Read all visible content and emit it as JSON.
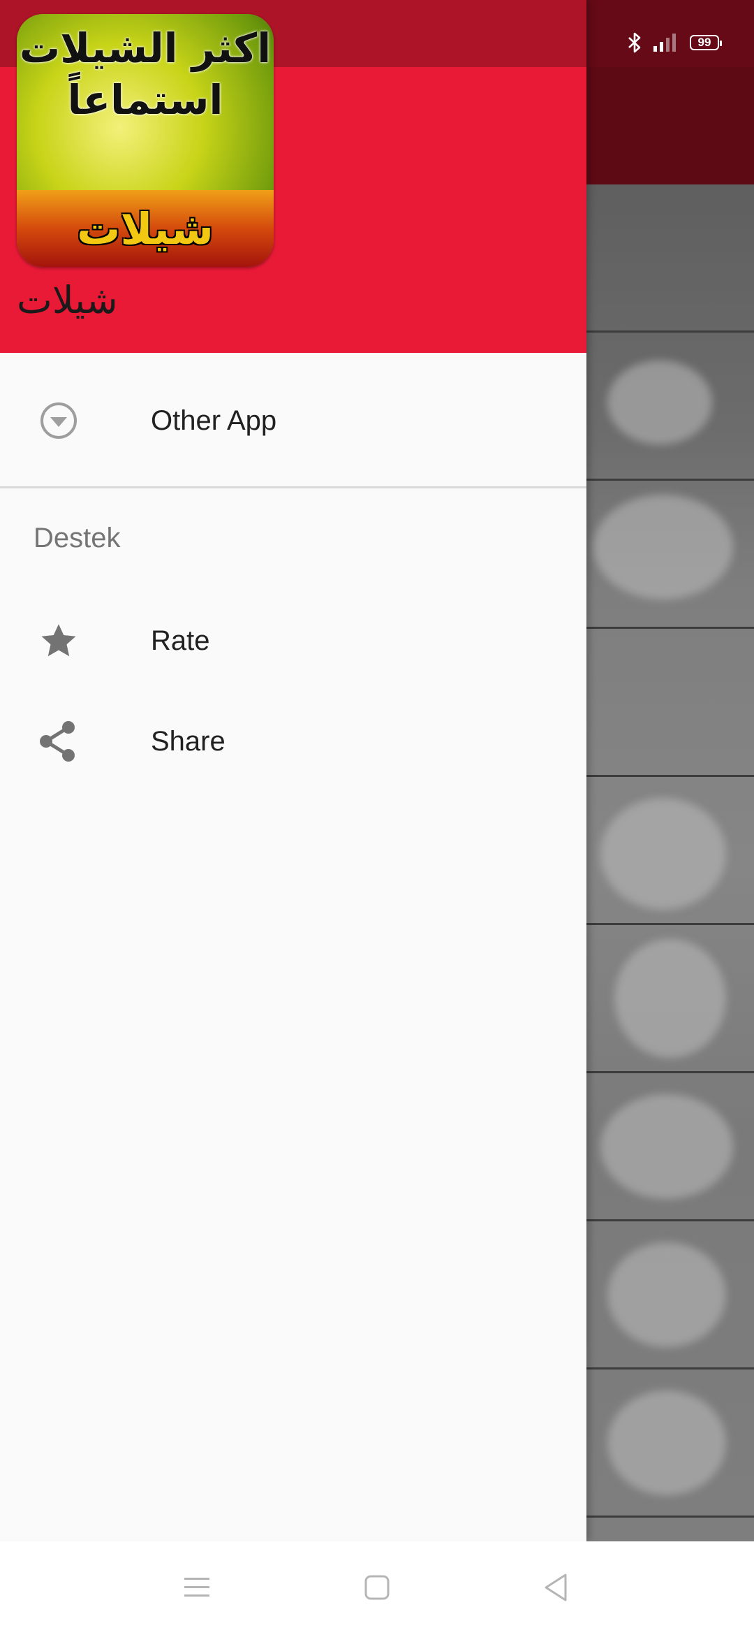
{
  "status_bar": {
    "battery_level": "99",
    "icons": [
      "bluetooth-icon",
      "signal-icon",
      "battery-icon"
    ]
  },
  "drawer": {
    "header": {
      "logo_text": "اكثر الشيلات استماعاً",
      "logo_badge": "شيلات",
      "app_name": "شيلات"
    },
    "items": [
      {
        "label": "Other App",
        "icon": "dropdown-circle-icon"
      }
    ],
    "section_title": "Destek",
    "support_items": [
      {
        "label": "Rate",
        "icon": "star-icon"
      },
      {
        "label": "Share",
        "icon": "share-icon"
      }
    ]
  },
  "colors": {
    "header_red": "#e81a36",
    "header_status_red": "#ad1428",
    "scrim_dark_red": "#650a16"
  },
  "navbar": {
    "icons": [
      "menu-icon",
      "home-icon",
      "back-icon"
    ]
  }
}
